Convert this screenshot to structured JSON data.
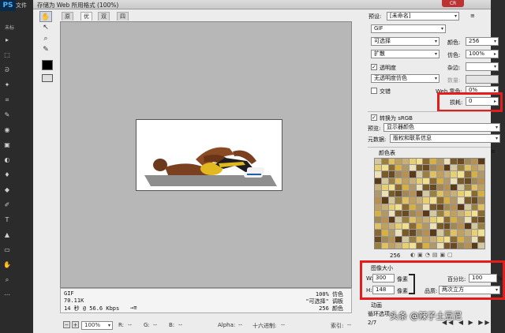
{
  "ps": {
    "logo": "PS",
    "menu": "文件",
    "doc_tab": "未标",
    "tools": [
      "▸",
      "⬚",
      "ᘐ",
      "✦",
      "⌗",
      "✎",
      "◉",
      "▣",
      "◐",
      "♦",
      "◆",
      "✐",
      "T",
      "▲",
      "▭",
      "✋",
      "⌕",
      "⋯"
    ]
  },
  "dialog": {
    "title": "存储为 Web 所用格式 (100%)",
    "title_button": "CR"
  },
  "tabs": [
    "原稿",
    "优化",
    "双联",
    "四联"
  ],
  "info": {
    "format": "GIF",
    "size": "70.11K",
    "time": "14 秒 @ 56.6 Kbps",
    "arrow": "→≡",
    "dither": "100% 仿色",
    "palette": "\"可选择\" 调板",
    "colors": "256 颜色"
  },
  "status": {
    "zoom": "100%",
    "r": "R:",
    "r_val": "--",
    "g": "G:",
    "g_val": "--",
    "b": "B:",
    "b_val": "--",
    "alpha": "Alpha:",
    "alpha_val": "--",
    "hex": "十六进制:",
    "hex_val": "--",
    "index": "索引:",
    "index_val": "--"
  },
  "settings": {
    "preset_label": "预设:",
    "preset_value": "[未命名]",
    "format_value": "GIF",
    "reduction": "可选择",
    "colors_label": "颜色:",
    "colors_value": "256",
    "dither_algo": "扩散",
    "dither_label": "仿色:",
    "dither_value": "100%",
    "transparency": "透明度",
    "matte_label": "杂边:",
    "trans_dither": "无透明度仿色",
    "amount_label": "数量:",
    "interlaced": "交错",
    "web_snap_label": "Web 靠色:",
    "web_snap_value": "0%",
    "lossy_label": "损耗:",
    "lossy_value": "0",
    "convert_srgb": "转换为 sRGB",
    "preview_label": "预览:",
    "preview_value": "显示器颜色",
    "metadata_label": "元数据:",
    "metadata_value": "版权和联系信息",
    "color_table": "颜色表",
    "table_count": "256",
    "image_size": "图像大小",
    "w_label": "W:",
    "w_value": "300",
    "h_label": "H:",
    "h_value": "148",
    "unit": "像素",
    "percent_label": "百分比:",
    "percent_value": "100",
    "percent_unit": "%",
    "quality_label": "品质:",
    "quality_value": "两次立方",
    "animation": "动画",
    "loop_label": "循环选项:",
    "frame_counter": "2/7"
  },
  "watermark": "头条 @辣子土豆尼",
  "palette_colors": [
    "#d4c8a0",
    "#8a6a30",
    "#b89050",
    "#e8d070",
    "#6a4a20",
    "#c0a060",
    "#ece0b8",
    "#9a8040",
    "#d8b040",
    "#5a3a18",
    "#f0e090",
    "#a08858",
    "#c8b078",
    "#7a5a28",
    "#e0c060",
    "#b09868"
  ]
}
